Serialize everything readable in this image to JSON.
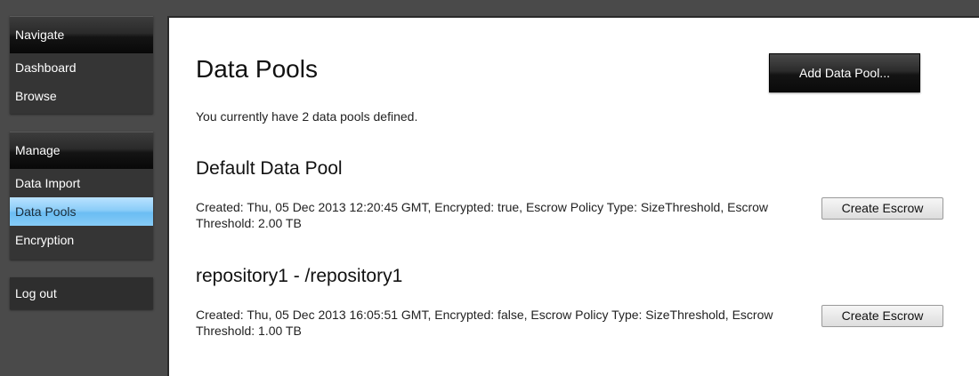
{
  "sidebar": {
    "navigate": {
      "header": "Navigate",
      "items": [
        "Dashboard",
        "Browse"
      ]
    },
    "manage": {
      "header": "Manage",
      "items": [
        "Data Import",
        "Data Pools",
        "Encryption"
      ],
      "active_item": "Data Pools"
    },
    "logout": "Log out"
  },
  "main": {
    "title": "Data Pools",
    "add_button": "Add Data Pool...",
    "summary": "You currently have 2 data pools defined.",
    "pools": [
      {
        "name": "Default Data Pool",
        "details": "Created: Thu, 05 Dec 2013 12:20:45 GMT, Encrypted: true, Escrow Policy Type: SizeThreshold, Escrow Threshold: 2.00 TB",
        "button": "Create Escrow"
      },
      {
        "name": "repository1 - /repository1",
        "details": "Created: Thu, 05 Dec 2013 16:05:51 GMT, Encrypted: false, Escrow Policy Type: SizeThreshold, Escrow Threshold: 1.00 TB",
        "button": "Create Escrow"
      }
    ]
  },
  "colors": {
    "background": "#4a4a4a",
    "active_nav": "#8bcdf8",
    "panel": "#ffffff"
  }
}
